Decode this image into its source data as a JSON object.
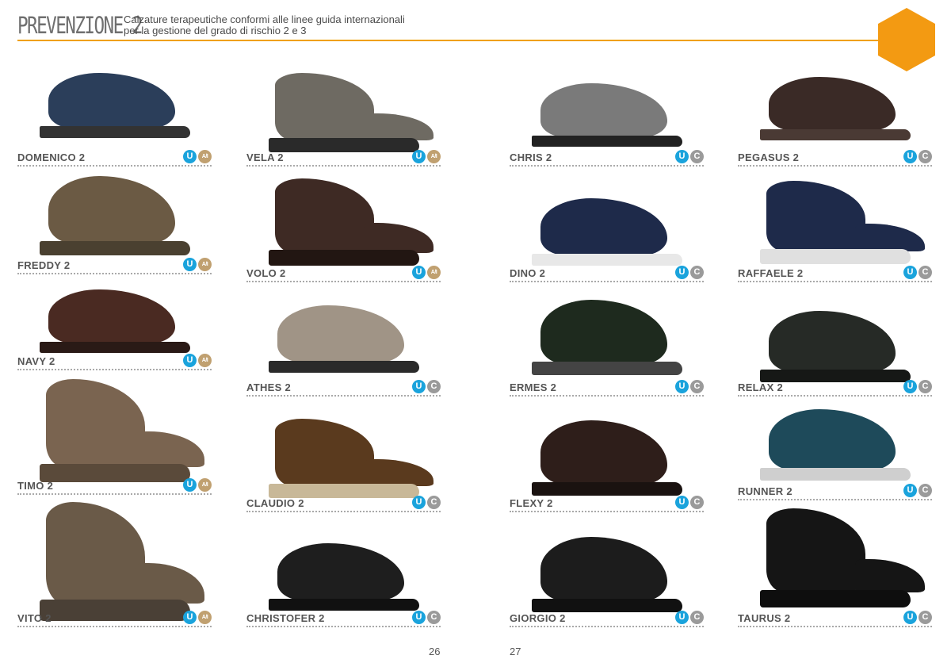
{
  "header": {
    "title": "PREVENZIONE 2",
    "subtitle_line1": "Calzature terapeutiche conformi alle linee guida internazionali",
    "subtitle_line2": "per la gestione del grado di rischio 2 e 3"
  },
  "colors": {
    "accent": "#f39a12",
    "badge_u": "#1aa3dc",
    "badge_a": "#c0a070",
    "badge_c": "#9a9a9a"
  },
  "badge_text": {
    "u": "U",
    "a": "A/I",
    "c": "C"
  },
  "pages": {
    "left": "26",
    "right": "27"
  },
  "products": [
    {
      "name": "DOMENICO 2",
      "badge2": "a",
      "style": "shoe",
      "upper": "#2b3e5a",
      "sole": "#333333"
    },
    {
      "name": "FREDDY 2",
      "badge2": "a",
      "style": "shoe",
      "upper": "#6b5a44",
      "sole": "#4a4030"
    },
    {
      "name": "NAVY 2",
      "badge2": "a",
      "style": "shoe",
      "upper": "#4a2a22",
      "sole": "#2a1a16"
    },
    {
      "name": "TIMO 2",
      "badge2": "a",
      "style": "boot",
      "upper": "#7a6450",
      "sole": "#5a4a3a"
    },
    {
      "name": "VITO 2",
      "badge2": "a",
      "style": "boot",
      "upper": "#6a5a48",
      "sole": "#4a4036"
    },
    {
      "name": "VELA 2",
      "badge2": "a",
      "style": "boot",
      "upper": "#6e6a62",
      "sole": "#2a2a2a"
    },
    {
      "name": "VOLO 2",
      "badge2": "a",
      "style": "boot",
      "upper": "#3e2a24",
      "sole": "#221612"
    },
    {
      "name": "ATHES 2",
      "badge2": "c",
      "style": "shoe",
      "upper": "#a09486",
      "sole": "#2a2a2a"
    },
    {
      "name": "CLAUDIO 2",
      "badge2": "c",
      "style": "boot",
      "upper": "#5a3a1e",
      "sole": "#c8b898"
    },
    {
      "name": "CHRISTOFER 2",
      "badge2": "c",
      "style": "shoe",
      "upper": "#1e1e1e",
      "sole": "#111111"
    },
    {
      "name": "CHRIS 2",
      "badge2": "c",
      "style": "shoe",
      "upper": "#7a7a7a",
      "sole": "#222222"
    },
    {
      "name": "DINO 2",
      "badge2": "c",
      "style": "shoe",
      "upper": "#1e2a4a",
      "sole": "#e8e8e8"
    },
    {
      "name": "ERMES 2",
      "badge2": "c",
      "style": "shoe",
      "upper": "#1e2a1e",
      "sole": "#444444"
    },
    {
      "name": "FLEXY 2",
      "badge2": "c",
      "style": "shoe",
      "upper": "#2e1e1a",
      "sole": "#1a1210"
    },
    {
      "name": "GIORGIO 2",
      "badge2": "c",
      "style": "shoe",
      "upper": "#1c1c1c",
      "sole": "#111111"
    },
    {
      "name": "PEGASUS 2",
      "badge2": "c",
      "style": "shoe",
      "upper": "#3a2a26",
      "sole": "#4a3a34"
    },
    {
      "name": "RAFFAELE 2",
      "badge2": "c",
      "style": "boot",
      "upper": "#1e2a4a",
      "sole": "#e0e0e0"
    },
    {
      "name": "RELAX 2",
      "badge2": "c",
      "style": "shoe",
      "upper": "#262a26",
      "sole": "#161816"
    },
    {
      "name": "RUNNER 2",
      "badge2": "c",
      "style": "shoe",
      "upper": "#1e4a5a",
      "sole": "#cfcfcf"
    },
    {
      "name": "TAURUS 2",
      "badge2": "c",
      "style": "boot",
      "upper": "#151515",
      "sole": "#0e0e0e"
    }
  ]
}
